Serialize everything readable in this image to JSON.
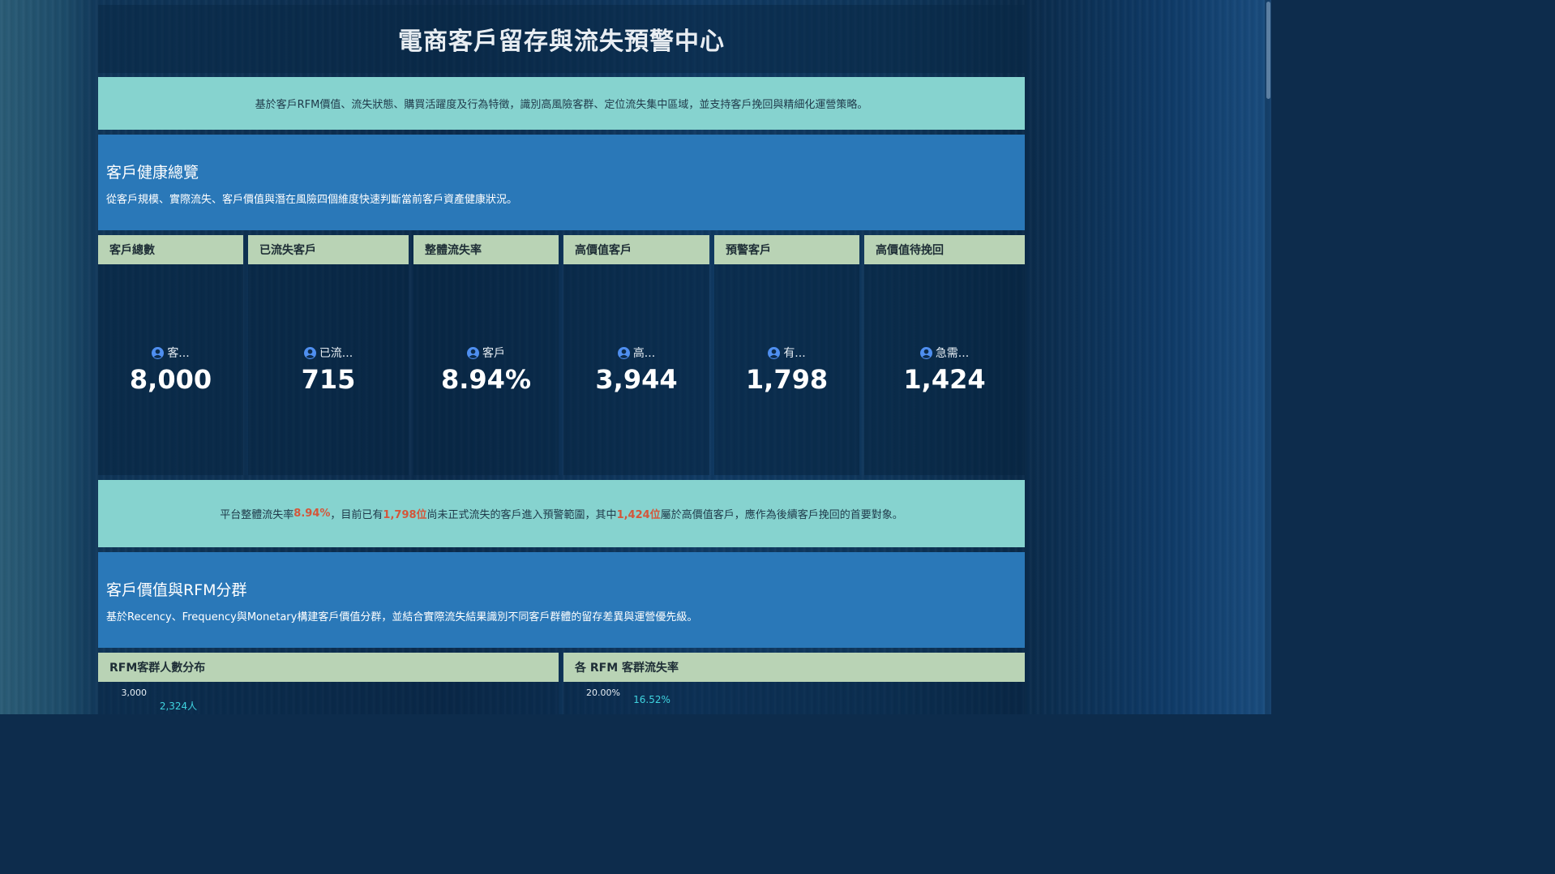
{
  "header": {
    "title": "電商客戶留存與流失預警中心"
  },
  "intro": "基於客戶RFM價值、流失狀態、購買活躍度及行為特徵，識別高風險客群、定位流失集中區域，並支持客戶挽回與精細化運營策略。",
  "health_section": {
    "title": "客戶健康總覽",
    "description": "從客戶規模、實際流失、客戶價值與潛在風險四個維度快速判斷當前客戶資產健康狀況。"
  },
  "kpis": [
    {
      "title": "客戶總數",
      "label": "客...",
      "value": "8,000"
    },
    {
      "title": "已流失客戶",
      "label": "已流...",
      "value": "715"
    },
    {
      "title": "整體流失率",
      "label": "客戶",
      "value": "8.94%"
    },
    {
      "title": "高價值客戶",
      "label": "高...",
      "value": "3,944"
    },
    {
      "title": "預警客戶",
      "label": "有...",
      "value": "1,798"
    },
    {
      "title": "高價值待挽回",
      "label": "急需...",
      "value": "1,424"
    }
  ],
  "alert": {
    "p1": "平台整體流失率",
    "v1": "8.94%",
    "p2": "，目前已有",
    "v2": "1,798位",
    "p3": "尚未正式流失的客戶進入預警範圍，其中",
    "v3": "1,424位",
    "p4": "屬於高價值客戶，應作為後續客戶挽回的首要對象。"
  },
  "rfm_section": {
    "title": "客戶價值與RFM分群",
    "description": "基於Recency、Frequency與Monetary構建客戶價值分群，並結合實際流失結果識別不同客戶群體的留存差異與運營優先級。"
  },
  "chart_data": [
    {
      "type": "bar",
      "title": "RFM客群人數分布",
      "ytick_labels": [
        "3,000"
      ],
      "ylim": [
        0,
        3000
      ],
      "values": [
        2324
      ],
      "data_labels": [
        "2,324人"
      ]
    },
    {
      "type": "bar",
      "title": "各 RFM 客群流失率",
      "ytick_labels": [
        "20.00%"
      ],
      "ylim": [
        0,
        20
      ],
      "values": [
        16.52
      ],
      "data_labels": [
        "16.52%"
      ]
    }
  ],
  "colors": {
    "accent_teal": "#86d3cf",
    "section_blue": "#2a78b8",
    "card_header": "#b9d3b5",
    "highlight": "#d4563a",
    "bar": "#3fd4e0"
  },
  "icons": {
    "kpi_icon": "user-circle-icon"
  }
}
